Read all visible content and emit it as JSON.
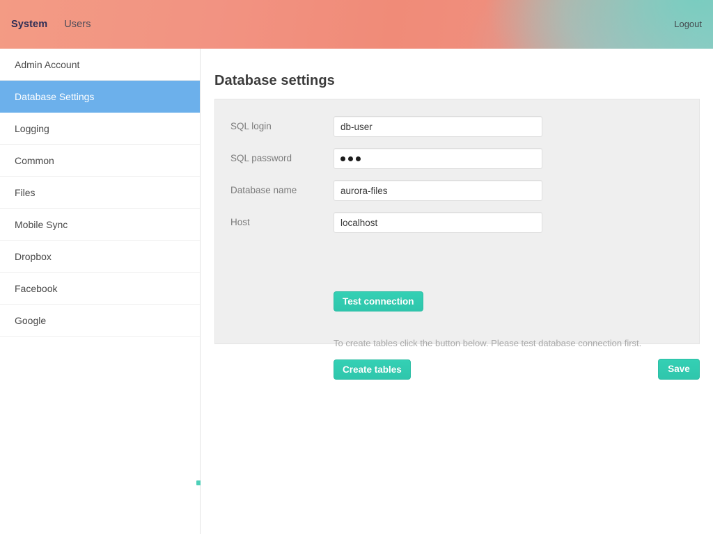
{
  "header": {
    "nav_items": [
      {
        "label": "System",
        "active": true
      },
      {
        "label": "Users",
        "active": false
      }
    ],
    "logout_label": "Logout",
    "gradient_start_color": "#f18e7c",
    "gradient_end_color": "#93cac3"
  },
  "sidebar": {
    "items": [
      {
        "label": "Admin Account",
        "selected": false
      },
      {
        "label": "Database Settings",
        "selected": true
      },
      {
        "label": "Logging",
        "selected": false
      },
      {
        "label": "Common",
        "selected": false
      },
      {
        "label": "Files",
        "selected": false
      },
      {
        "label": "Mobile Sync",
        "selected": false
      },
      {
        "label": "Dropbox",
        "selected": false
      },
      {
        "label": "Facebook",
        "selected": false
      },
      {
        "label": "Google",
        "selected": false
      }
    ],
    "selected_bg_color": "#6cb0eb"
  },
  "main": {
    "page_title": "Database settings",
    "panel_bg_color": "#efefef",
    "fields": [
      {
        "label": "SQL login",
        "value": "db-user",
        "placeholder": "",
        "type": "text"
      },
      {
        "label": "SQL password",
        "value": "•••",
        "placeholder": "",
        "type": "password",
        "masked_chars": 3
      },
      {
        "label": "Database name",
        "value": "aurora-files",
        "placeholder": "",
        "type": "text"
      },
      {
        "label": "Host",
        "value": "localhost",
        "placeholder": "",
        "type": "text"
      }
    ],
    "test_connection_label": "Test connection",
    "create_tables_hint": "To create tables click the button below. Please test database connection first.",
    "create_tables_label": "Create tables",
    "save_label": "Save",
    "accent_color": "#2fc6ac"
  }
}
